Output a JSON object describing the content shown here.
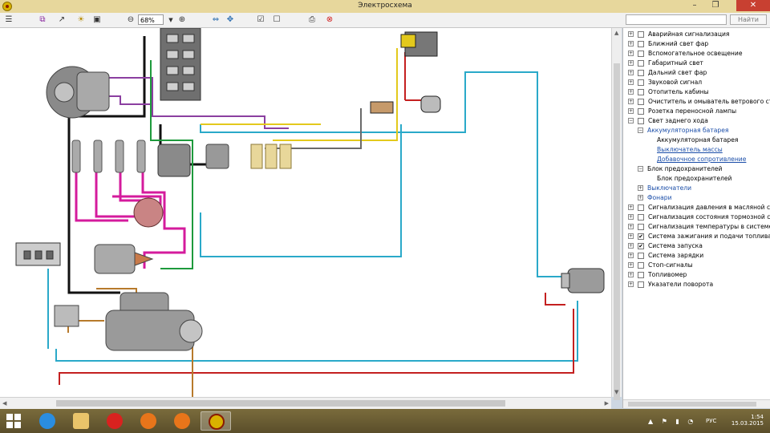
{
  "window": {
    "title": "Электросхема"
  },
  "toolbar": {
    "zoom_value": "68%",
    "search_value": "",
    "search_button": "Найти"
  },
  "tree": {
    "items": [
      {
        "label": "Аварийная сигнализация",
        "expander": "+",
        "checked": false
      },
      {
        "label": "Ближний свет фар",
        "expander": "+",
        "checked": false
      },
      {
        "label": "Вспомогательное освещение",
        "expander": "+",
        "checked": false
      },
      {
        "label": "Габаритный свет",
        "expander": "+",
        "checked": false
      },
      {
        "label": "Дальний свет фар",
        "expander": "+",
        "checked": false
      },
      {
        "label": "Звуковой сигнал",
        "expander": "+",
        "checked": false
      },
      {
        "label": "Отопитель кабины",
        "expander": "+",
        "checked": false
      },
      {
        "label": "Очиститель и омыватель ветрового стекл",
        "expander": "+",
        "checked": false
      },
      {
        "label": "Розетка переносной лампы",
        "expander": "+",
        "checked": false
      },
      {
        "label": "Свет заднего хода",
        "expander": "−",
        "checked": false
      }
    ],
    "sub_battery": "Аккумуляторная батарея",
    "sub_battery_child": "Аккумуляторная батарея",
    "link_switch": "Выключатель массы",
    "link_resistor": "Добавочное сопротивление",
    "fuse_block": "Блок предохранителей",
    "fuse_block_child": "Блок предохранителей",
    "switches": "Выключатели",
    "lights": "Фонари",
    "items2": [
      {
        "label": "Сигнализация давления в масляной систе",
        "checked": false
      },
      {
        "label": "Сигнализация состояния тормозной систе",
        "checked": false
      },
      {
        "label": "Сигнализация температуры в системе охл",
        "checked": false
      },
      {
        "label": "Система зажигания и подачи топлива",
        "checked": true
      },
      {
        "label": "Система запуска",
        "checked": true
      },
      {
        "label": "Система зарядки",
        "checked": false
      },
      {
        "label": "Стоп-сигналы",
        "checked": false
      },
      {
        "label": "Топливомер",
        "checked": false
      },
      {
        "label": "Указатели поворота",
        "checked": false
      }
    ]
  },
  "tray": {
    "language": "РУС",
    "time": "1:54",
    "date": "15.03.2015"
  },
  "colors": {
    "titlebar": "#e7d79c",
    "close": "#c84031",
    "accent_link": "#1a4da8"
  }
}
